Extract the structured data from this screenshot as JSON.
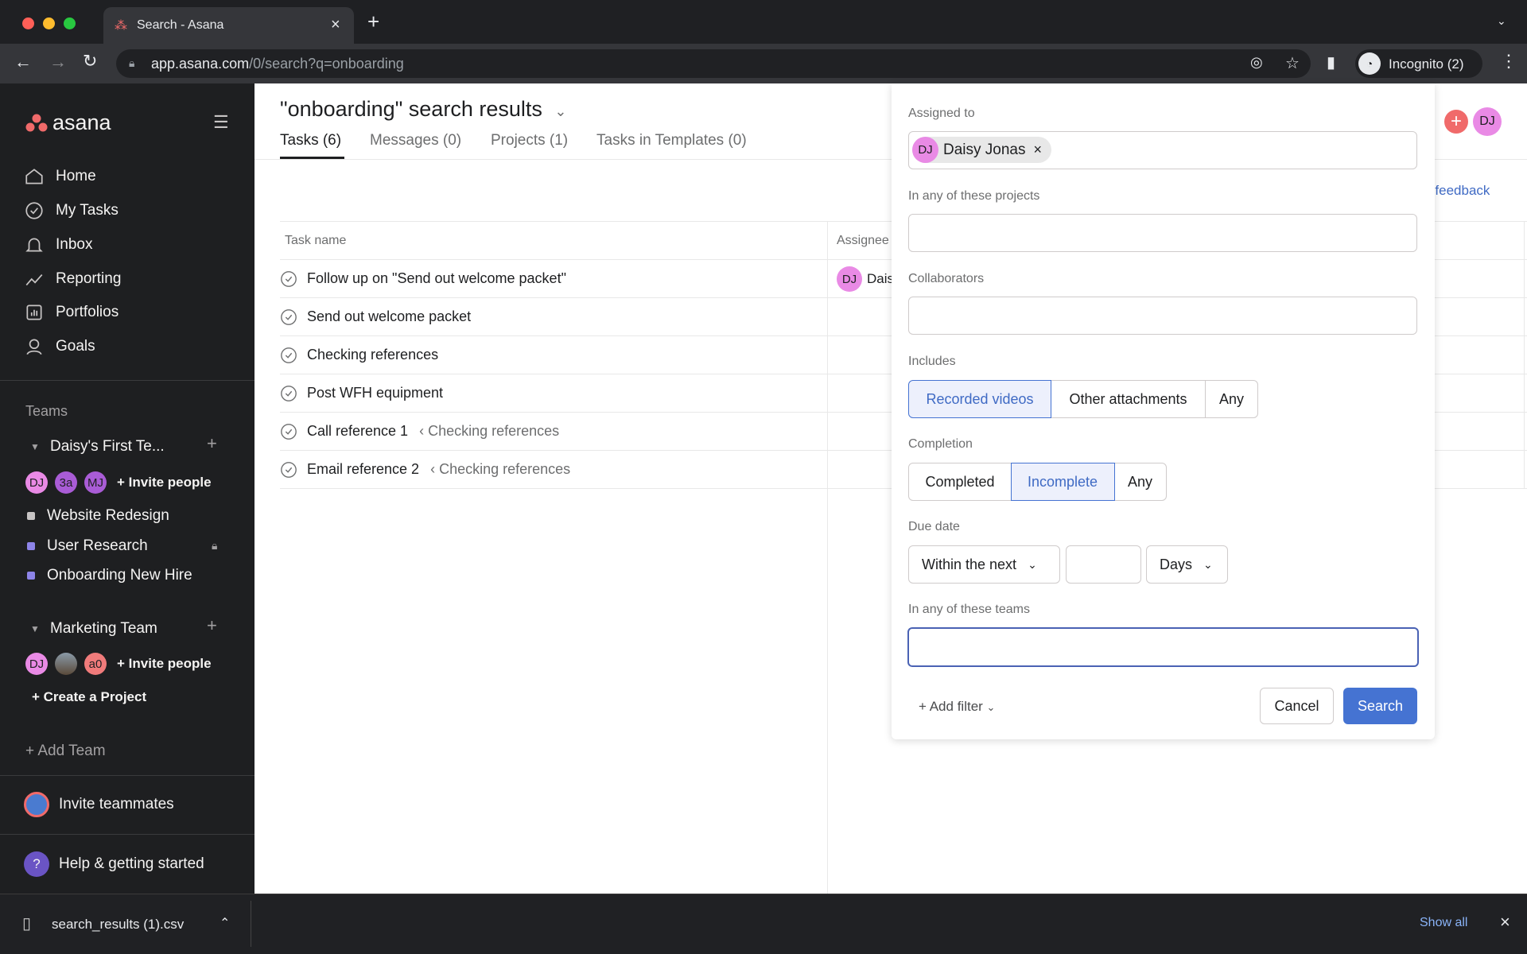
{
  "browser": {
    "tab_title": "Search - Asana",
    "url_host": "app.asana.com",
    "url_path": "/0/search?q=onboarding",
    "profile": "Incognito (2)"
  },
  "sidebar": {
    "logo": "asana",
    "nav": [
      {
        "label": "Home",
        "icon": "home-icon"
      },
      {
        "label": "My Tasks",
        "icon": "check-circle-icon"
      },
      {
        "label": "Inbox",
        "icon": "bell-icon"
      },
      {
        "label": "Reporting",
        "icon": "chart-line-icon"
      },
      {
        "label": "Portfolios",
        "icon": "bar-chart-icon"
      },
      {
        "label": "Goals",
        "icon": "person-icon"
      }
    ],
    "teams_label": "Teams",
    "teams": [
      {
        "name": "Daisy's First Te...",
        "members": [
          "DJ",
          "3a",
          "MJ"
        ],
        "invite": "Invite people",
        "projects": [
          {
            "name": "Website Redesign",
            "color": "#c7c4c4"
          },
          {
            "name": "User Research",
            "color": "#8d84e8",
            "locked": true
          },
          {
            "name": "Onboarding New Hire",
            "color": "#8d84e8"
          }
        ]
      },
      {
        "name": "Marketing Team",
        "members": [
          "DJ",
          "",
          "a0"
        ],
        "invite": "Invite people",
        "create": "Create a Project"
      }
    ],
    "add_team": "Add Team",
    "invite_teammates": "Invite teammates",
    "help": "Help & getting started"
  },
  "main": {
    "title": "\"onboarding\" search results",
    "tabs": [
      "Tasks (6)",
      "Messages (0)",
      "Projects (1)",
      "Tasks in Templates (0)"
    ],
    "feedback": "Send feedback",
    "columns": [
      "Task name",
      "Assignee"
    ],
    "rows": [
      {
        "name": "Follow up on \"Send out welcome packet\"",
        "parent": "",
        "assignee": "Daisy Jonas",
        "assignee_initials": "DJ"
      },
      {
        "name": "Send out welcome packet",
        "parent": ""
      },
      {
        "name": "Checking references",
        "parent": ""
      },
      {
        "name": "Post WFH equipment",
        "parent": ""
      },
      {
        "name": "Call reference 1",
        "parent": "‹ Checking references"
      },
      {
        "name": "Email reference 2",
        "parent": "‹ Checking references"
      }
    ],
    "user_initials": "DJ"
  },
  "filter": {
    "assigned_label": "Assigned to",
    "assigned_chip": "Daisy Jonas",
    "assigned_initials": "DJ",
    "projects_label": "In any of these projects",
    "collab_label": "Collaborators",
    "includes_label": "Includes",
    "includes": [
      "Recorded videos",
      "Other attachments",
      "Any"
    ],
    "includes_selected": "Recorded videos",
    "completion_label": "Completion",
    "completion": [
      "Completed",
      "Incomplete",
      "Any"
    ],
    "completion_selected": "Incomplete",
    "due_label": "Due date",
    "due_mode": "Within the next",
    "due_value": "",
    "due_unit": "Days",
    "teams_label": "In any of these teams",
    "add_filter": "Add filter",
    "cancel": "Cancel",
    "search": "Search"
  },
  "download": {
    "file": "search_results (1).csv",
    "show_all": "Show all"
  },
  "colors": {
    "accent": "#4573d2",
    "brand": "#f06a6a",
    "sidebar": "#1e1f21",
    "avatar_pink": "#e98ae5"
  }
}
